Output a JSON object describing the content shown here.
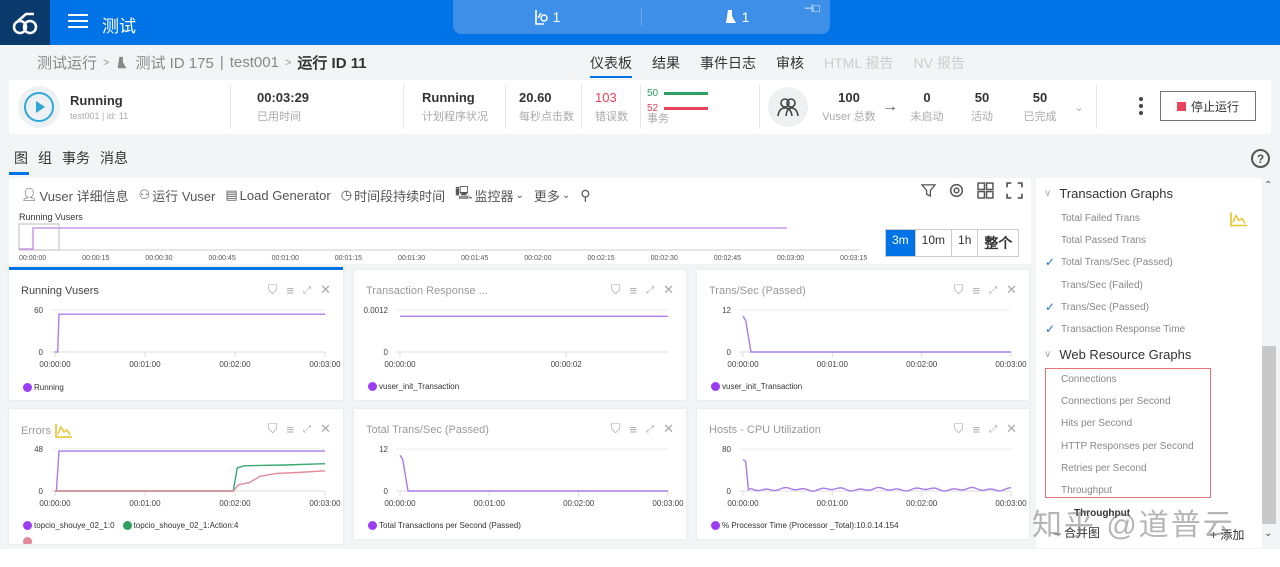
{
  "topbar": {
    "app_title": "测试",
    "center_panel": [
      {
        "icon": "chart-search-icon",
        "count": "1"
      },
      {
        "icon": "load-test-icon",
        "count": "1"
      }
    ],
    "brand_color": "#0073e7"
  },
  "breadcrumb": {
    "root": "测试运行",
    "test": "测试 ID 175",
    "test_name": "test001",
    "current": "运行 ID 11"
  },
  "nav_tabs": [
    {
      "label": "仪表板",
      "active": true
    },
    {
      "label": "结果"
    },
    {
      "label": "事件日志"
    },
    {
      "label": "审核"
    },
    {
      "label": "HTML 报告",
      "disabled": true
    },
    {
      "label": "NV 报告",
      "disabled": true
    }
  ],
  "status": {
    "state": "Running",
    "run_info": "test001 | id: 11",
    "elapsed": "00:03:29",
    "elapsed_label": "已用时间",
    "scheduler": "Running",
    "scheduler_label": "计划程序状况",
    "hits_per_sec": "20.60",
    "hits_label": "每秒点击数",
    "errors": "103",
    "errors_label": "错误数",
    "trans_passed": "50",
    "trans_failed": "52",
    "trans_label": "事务",
    "vuser_total": "100",
    "vuser_total_label": "Vuser 总数",
    "not_started": "0",
    "not_started_label": "未启动",
    "active": "50",
    "active_label": "活动",
    "finished": "50",
    "finished_label": "已完成",
    "stop_label": "停止运行"
  },
  "subtabs": [
    "图",
    "组",
    "事务",
    "消息"
  ],
  "toolbar": {
    "vuser_details": "Vuser 详细信息",
    "run_vuser": "运行 Vuser",
    "load_generator": "Load Generator",
    "timeslot": "时间段持续时间",
    "monitors": "监控器",
    "more": "更多"
  },
  "overview": {
    "title": "Running Vusers",
    "ticks": [
      "00:00:00",
      "00:00:15",
      "00:00:30",
      "00:00:45",
      "00:01:00",
      "00:01:15",
      "00:01:30",
      "00:01:45",
      "00:02:00",
      "00:02:15",
      "00:02:30",
      "00:02:45",
      "00:03:00",
      "00:03:15"
    ],
    "ranges": [
      "3m",
      "10m",
      "1h",
      "整个"
    ],
    "active_range": "3m"
  },
  "cards": [
    {
      "title": "Running Vusers",
      "ymax": "60",
      "xticks": [
        "00:00:00",
        "00:01:00",
        "00:02:00",
        "00:03:00"
      ],
      "legend": [
        {
          "label": "Running",
          "color": "#9b3df5"
        }
      ]
    },
    {
      "title": "Transaction Response ...",
      "ymax": "0.0012",
      "xticks": [
        "00:00:00",
        "00:00:02"
      ],
      "legend": [
        {
          "label": "vuser_init_Transaction",
          "color": "#9b3df5"
        }
      ]
    },
    {
      "title": "Trans/Sec (Passed)",
      "ymax": "12",
      "xticks": [
        "00:00:00",
        "00:01:00",
        "00:02:00",
        "00:03:00"
      ],
      "legend": [
        {
          "label": "vuser_init_Transaction",
          "color": "#9b3df5"
        }
      ]
    },
    {
      "title": "Errors",
      "ymax": "48",
      "xticks": [
        "00:00:00",
        "00:01:00",
        "00:02:00",
        "00:03:00"
      ],
      "legend": [
        {
          "label": "topcio_shouye_02_1:0",
          "color": "#9b3df5"
        },
        {
          "label": "topcio_shouye_02_1:Action:4",
          "color": "#2e9e62"
        }
      ]
    },
    {
      "title": "Total Trans/Sec (Passed)",
      "ymax": "12",
      "xticks": [
        "00:00:00",
        "00:01:00",
        "00:02:00",
        "00:03:00"
      ],
      "legend": [
        {
          "label": "Total Transactions per Second (Passed)",
          "color": "#9b3df5"
        }
      ]
    },
    {
      "title": "Hosts - CPU Utilization",
      "ymax": "80",
      "xticks": [
        "00:00:00",
        "00:01:00",
        "00:02:00",
        "00:03:00"
      ],
      "legend": [
        {
          "label": "% Processor Time (Processor _Total):10.0.14.154",
          "color": "#9b3df5"
        }
      ]
    }
  ],
  "zero_label": "0",
  "side": {
    "group1": "Transaction Graphs",
    "group1_items": [
      {
        "label": "Total Failed Trans",
        "checked": false
      },
      {
        "label": "Total Passed Trans",
        "checked": false
      },
      {
        "label": "Total Trans/Sec (Passed)",
        "checked": true
      },
      {
        "label": "Trans/Sec (Failed)",
        "checked": false
      },
      {
        "label": "Trans/Sec (Passed)",
        "checked": true
      },
      {
        "label": "Transaction Response Time",
        "checked": true
      }
    ],
    "group2": "Web Resource Graphs",
    "group2_items": [
      {
        "label": "Connections"
      },
      {
        "label": "Connections per Second"
      },
      {
        "label": "Hits per Second"
      },
      {
        "label": "HTTP Responses per Second"
      },
      {
        "label": "Retries per Second"
      },
      {
        "label": "Throughput"
      }
    ],
    "drag_item": "Throughput",
    "open_graph": "– 合并图",
    "add": "+ 添加"
  },
  "watermark": "知乎 @道普云"
}
